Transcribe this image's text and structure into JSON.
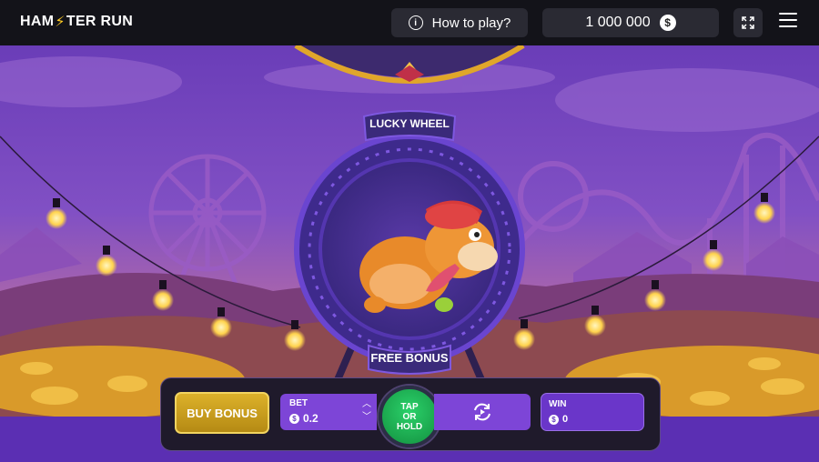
{
  "header": {
    "logo_text_left": "HAM",
    "logo_bolt": "⚡",
    "logo_text_right": "TER RUN",
    "how_to_play_label": "How to play?",
    "info_icon_glyph": "i",
    "balance": "1 000 000",
    "currency_glyph": "$"
  },
  "wheel": {
    "top_label": "LUCKY WHEEL",
    "bottom_label": "FREE BONUS"
  },
  "controls": {
    "buy_bonus_label": "BUY BONUS",
    "bet_label": "BET",
    "bet_value": "0.2",
    "currency_glyph": "$",
    "tap_line1": "TAP",
    "tap_line2": "OR",
    "tap_line3": "HOLD",
    "win_label": "WIN",
    "win_value": "0"
  },
  "icons": [
    "info-icon",
    "coin-icon",
    "fullscreen-icon",
    "menu-icon",
    "autoplay-icon",
    "chevron-up-icon",
    "chevron-down-icon"
  ],
  "colors": {
    "topbar": "#131319",
    "sky_purple": "#7a4cc0",
    "wheel_ring": "#5b35b8",
    "buy_bonus_gold": "#d6a923",
    "tap_green": "#1fb956",
    "panel_purple": "#7d45d7"
  }
}
